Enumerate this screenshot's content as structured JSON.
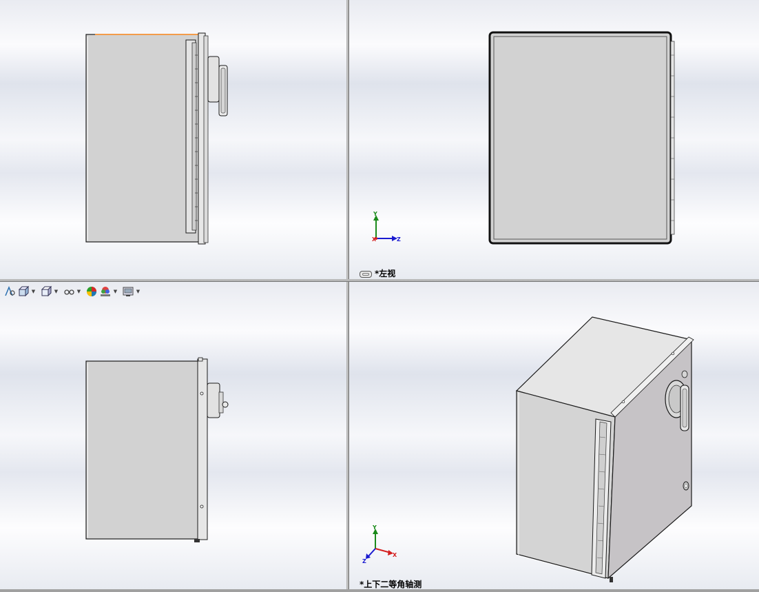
{
  "views": {
    "left": {
      "label": "*左视"
    },
    "isometric": {
      "label": "*上下二等角轴测"
    }
  },
  "triads": {
    "left": {
      "y": "Y",
      "z": "Z",
      "x": "X"
    },
    "iso": {
      "y": "Y",
      "z": "Z",
      "x": "X"
    }
  },
  "toolbar": {
    "items": [
      {
        "name": "zoom-to-fit-icon",
        "dropdown": false
      },
      {
        "name": "view-orientation-icon",
        "dropdown": true
      },
      {
        "name": "display-style-icon",
        "dropdown": true
      },
      {
        "name": "hide-show-items-icon",
        "dropdown": true
      },
      {
        "name": "edit-appearance-icon",
        "dropdown": false
      },
      {
        "name": "apply-scene-icon",
        "dropdown": true
      },
      {
        "name": "view-settings-icon",
        "dropdown": true
      }
    ]
  },
  "colors": {
    "panel_face": "#d2d2d2",
    "panel_iso_top": "#e4e4e4",
    "panel_iso_side": "#c4c2c4",
    "outline": "#1a1a1a",
    "highlight_edge": "#f39c4a",
    "axis_x": "#d42020",
    "axis_y": "#1a8a1a",
    "axis_z": "#1a1ad0"
  }
}
